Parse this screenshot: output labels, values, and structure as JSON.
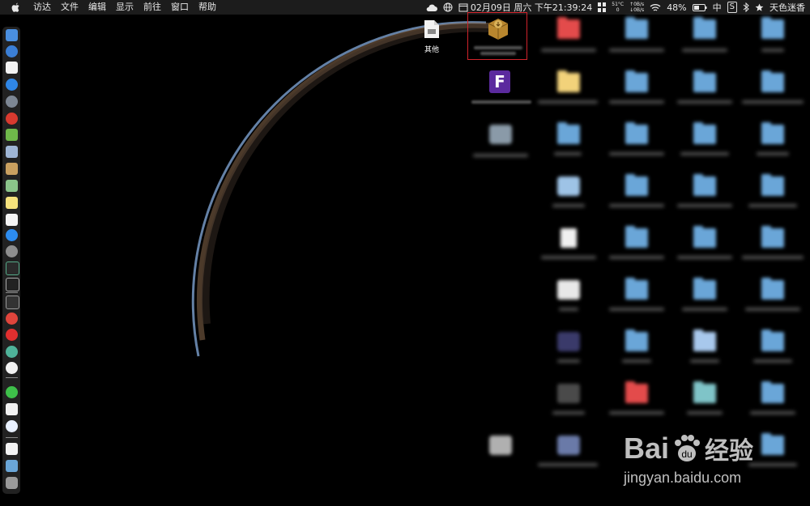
{
  "menubar": {
    "apple_label": "",
    "menus": [
      "访达",
      "文件",
      "编辑",
      "显示",
      "前往",
      "窗口",
      "帮助"
    ],
    "datetime": "02月09日 周六 下午21:39:24",
    "temperature": "51°C",
    "temp_sub": "0",
    "net_up": "↑0B/s",
    "net_down": "↓0B/s",
    "battery": "48%",
    "input_method": "中",
    "s_badge": "S",
    "user_name": "天色迷香"
  },
  "desktop": {
    "other_label": "其他"
  },
  "watermark": {
    "brand": "Bai",
    "brand_tail": "du",
    "cn": "经验",
    "url": "jingyan.baidu.com"
  },
  "colors": {
    "folder": "#6aa6d8",
    "folder_red": "#e34b4b",
    "folder_yellow": "#f2d27a",
    "highlight": "#d0232b"
  },
  "icons": [
    "apple-icon",
    "cloud-icon",
    "globe-icon",
    "calendar-icon",
    "grid-icon",
    "wifi-icon",
    "bluetooth-icon",
    "star-icon"
  ]
}
